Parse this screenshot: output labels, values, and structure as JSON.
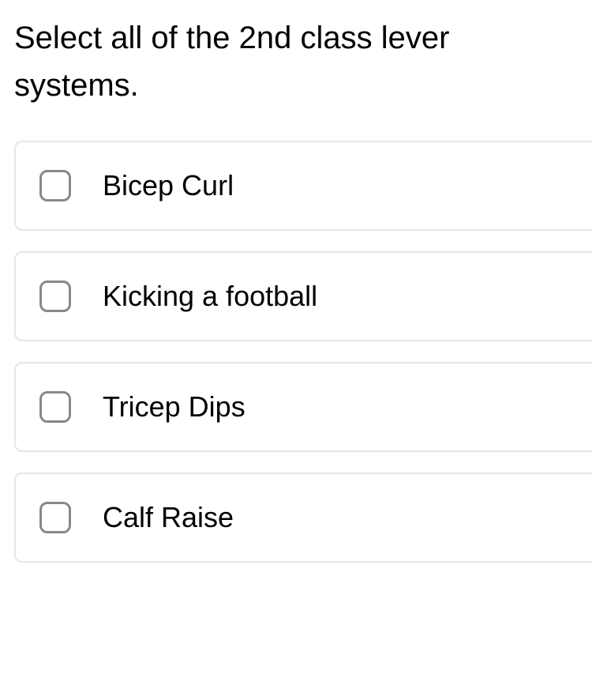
{
  "question": "Select all of the 2nd class lever systems.",
  "options": [
    {
      "label": "Bicep Curl"
    },
    {
      "label": "Kicking a football"
    },
    {
      "label": "Tricep Dips"
    },
    {
      "label": "Calf Raise"
    }
  ]
}
